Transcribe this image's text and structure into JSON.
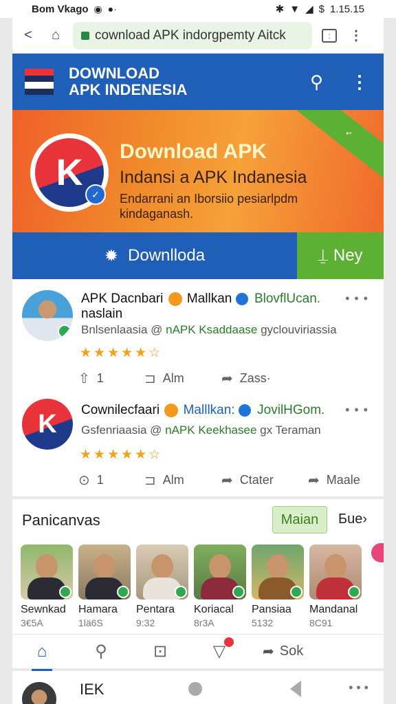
{
  "status_bar": {
    "carrier": "Bom Vkago",
    "time": "1.15.15"
  },
  "browser": {
    "url": "cownload APK indorgpemty Aitck"
  },
  "header": {
    "title_line1": "DOWNLOAD",
    "title_line2": "APK INDENESIA",
    "flag_colors": [
      "#e8333a",
      "#1b2e5e",
      "#ffffff",
      "#e8333a"
    ]
  },
  "hero": {
    "title": "Download APK",
    "subtitle": "Indansi a APK Indanesia",
    "desc": "Endarrani an Iborsiio pesiarlpdm kindaganash."
  },
  "actions": {
    "download_label": "Downlloda",
    "ney_label": "Ney"
  },
  "posts": [
    {
      "name": "APK Dacnbari",
      "meta_name": "Mallkan",
      "meta_link": "BlovflUcan.",
      "name_line2": "naslain",
      "line2_a": "Bnlsenlaasia @ ",
      "line2_b": "nAPK Ksaddaase",
      "line2_c": " gyclouviriassia",
      "rating": 4.5,
      "stars": "★★★★★☆",
      "actions": [
        {
          "icon": "like-icon",
          "label": "1"
        },
        {
          "icon": "repost-icon",
          "label": "Alm"
        },
        {
          "icon": "share-icon",
          "label": "Zass·"
        }
      ]
    },
    {
      "name": "Cownilecfaari",
      "meta_name": "Malllkan:",
      "meta_link": "JovilHGom.",
      "line2_a": "Gsfenriaasia @ ",
      "line2_b": "nAPK Keekhasee",
      "line2_c": " gx Teraman",
      "rating": 5,
      "stars": "★★★★★☆",
      "actions": [
        {
          "icon": "view-icon",
          "label": "1"
        },
        {
          "icon": "repost-icon",
          "label": "Alm"
        },
        {
          "icon": "share-icon",
          "label": "Ctater"
        },
        {
          "icon": "share-icon",
          "label": "Maale"
        }
      ]
    }
  ],
  "suggest": {
    "heading": "Panicanvas",
    "main_button": "Maian",
    "next_label": "Бue",
    "people": [
      {
        "name": "Sewnkad",
        "num": "3€5A"
      },
      {
        "name": "Hamara",
        "num": "1lä6S"
      },
      {
        "name": "Pentara",
        "num": "9:32"
      },
      {
        "name": "Koriacal",
        "num": "8r3A"
      },
      {
        "name": "Pansiaa",
        "num": "5132"
      },
      {
        "name": "Mandanal",
        "num": "8C91"
      }
    ]
  },
  "bottom_nav": {
    "sok_label": "Sok"
  },
  "peek": {
    "text": "IEK"
  }
}
